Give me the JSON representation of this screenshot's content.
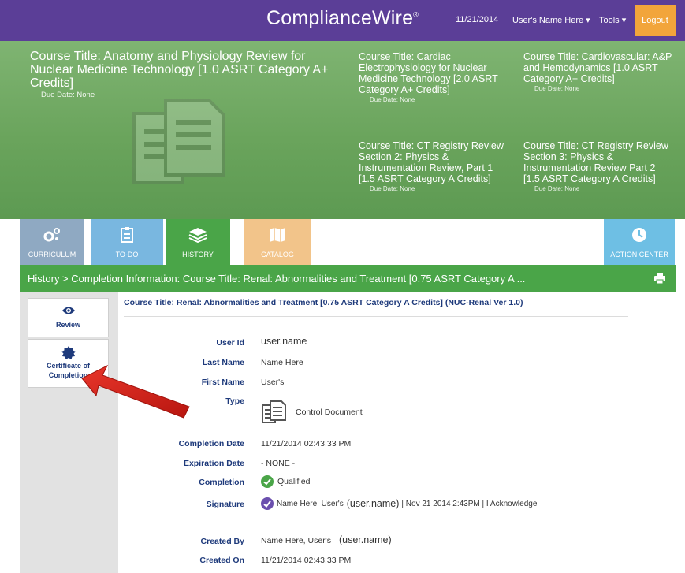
{
  "header": {
    "brand": "ComplianceWire",
    "brand_mark": "®",
    "date": "11/21/2014",
    "user_menu": "User's Name Here ▾",
    "tools_menu": "Tools ▾",
    "logout": "Logout"
  },
  "banner": {
    "featured": {
      "title": "Course Title: Anatomy and Physiology Review for Nuclear Medicine Technology [1.0 ASRT Category A+ Credits]",
      "due": "Due Date: None"
    },
    "tiles": [
      {
        "title": "Course Title: Cardiac Electrophysiology for Nuclear Medicine Technology [2.0 ASRT Category A+ Credits]",
        "due": "Due Date: None"
      },
      {
        "title": "Course Title: Cardiovascular: A&P and Hemodynamics [1.0 ASRT Category A+ Credits]",
        "due": "Due Date: None"
      },
      {
        "title": "Course Title: CT Registry Review Section 2: Physics & Instrumentation Review, Part 1 [1.5 ASRT Category A Credits]",
        "due": "Due Date: None"
      },
      {
        "title": "Course Title: CT Registry Review Section 3: Physics & Instrumentation Review Part 2 [1.5 ASRT Category A Credits]",
        "due": "Due Date: None"
      }
    ]
  },
  "tabs": {
    "curriculum": "CURRICULUM",
    "todo": "TO-DO",
    "history": "HISTORY",
    "catalog": "CATALOG",
    "action_center": "ACTION CENTER"
  },
  "breadcrumb": "History > Completion Information: Course Title: Renal: Abnormalities and Treatment [0.75 ASRT Category A ...",
  "sidebar": {
    "review": "Review",
    "certificate": "Certificate of Completion"
  },
  "detail": {
    "title": "Course Title: Renal: Abnormalities and Treatment [0.75 ASRT Category A Credits] (NUC-Renal Ver 1.0)",
    "labels": {
      "user_id": "User Id",
      "last_name": "Last Name",
      "first_name": "First Name",
      "type": "Type",
      "completion_date": "Completion Date",
      "expiration_date": "Expiration Date",
      "completion": "Completion",
      "signature": "Signature",
      "created_by": "Created By",
      "created_on": "Created On"
    },
    "values": {
      "user_id": "user.name",
      "last_name": "Name Here",
      "first_name": "User's",
      "type": "Control Document",
      "completion_date": "11/21/2014 02:43:33 PM",
      "expiration_date": "- NONE -",
      "completion": "Qualified",
      "signature_name": "Name Here, User's",
      "signature_user": "(user.name)",
      "signature_rest": "| Nov 21 2014 2:43PM | I Acknowledge",
      "created_by_name": "Name Here, User's",
      "created_by_user": "(user.name)",
      "created_on": "11/21/2014 02:43:33 PM"
    }
  },
  "colors": {
    "header": "#5b3e97",
    "logout": "#f2a53b",
    "history_green": "#4aa548",
    "banner_green": "#6aa45c",
    "label_blue": "#1e3a7b",
    "arrow_red": "#d9231d"
  }
}
